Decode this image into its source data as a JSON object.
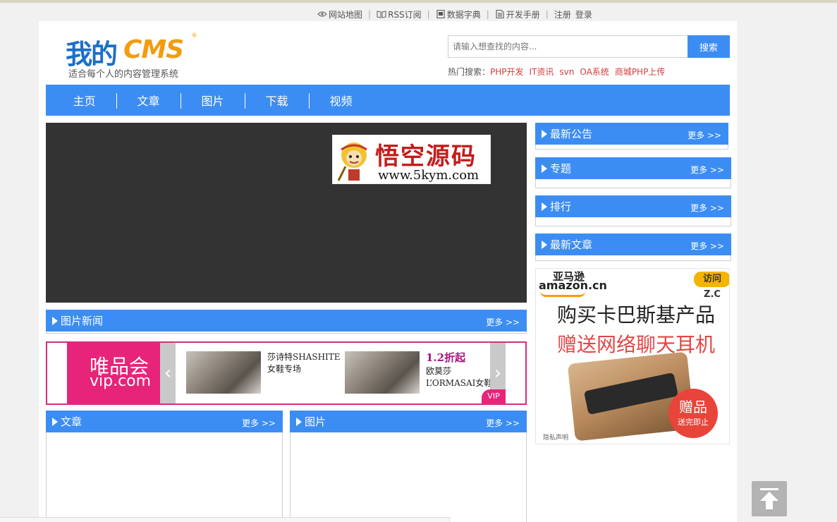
{
  "topbar": {
    "sitemap": "网站地图",
    "rss": "RSS订阅",
    "dict": "数据字典",
    "manual": "开发手册",
    "register": "注册",
    "login": "登录"
  },
  "logo": {
    "cn": "我的",
    "cms": "CMS",
    "reg": "®",
    "slogan": "适合每个人的内容管理系统"
  },
  "search": {
    "placeholder": "请输入想查找的内容...",
    "button": "搜索",
    "hot_label": "热门搜索：",
    "hot_terms": [
      "PHP开发",
      "IT资讯",
      "svn",
      "OA系统",
      "商城PHP上传"
    ]
  },
  "nav": [
    "主页",
    "文章",
    "图片",
    "下载",
    "视频"
  ],
  "watermark": {
    "title": "悟空源码",
    "url": "www.5kym.com"
  },
  "picture_news": {
    "title": "图片新闻",
    "more": "更多 >>"
  },
  "vip_ad": {
    "logo_cn": "唯品会",
    "logo_en": "vip.com",
    "item1_text_1": "莎诗特SHASHITE",
    "item1_text_2": "女鞋专场",
    "item2_price": "1.2折起",
    "item2_text_1": "欧莫莎",
    "item2_text_2": "L’ORMASAI女鞋",
    "badge": "VIP",
    "prev": "‹",
    "next": "›"
  },
  "articles": {
    "title": "文章",
    "more": "更多 >>"
  },
  "pictures": {
    "title": "图片",
    "more": "更多 >>"
  },
  "sidebar": {
    "notice": {
      "title": "最新公告",
      "more": "更多 >>"
    },
    "topic": {
      "title": "专题",
      "more": "更多 >>"
    },
    "rank": {
      "title": "排行",
      "more": "更多 >>"
    },
    "latest": {
      "title": "最新文章",
      "more": "更多 >>"
    }
  },
  "amazon_ad": {
    "brand_cn": "亚马逊",
    "brand_en": "amazon.cn",
    "badge": "访问 Z.C",
    "headline_1": "购买卡巴斯基产品",
    "headline_2": "赠送网络聊天耳机",
    "gift_1": "赠品",
    "gift_2": "送完即止",
    "privacy": "隐私声明"
  },
  "colors": {
    "accent": "#3c8df3",
    "hot_link": "#d63b3b",
    "vip_pink": "#e8237a"
  }
}
